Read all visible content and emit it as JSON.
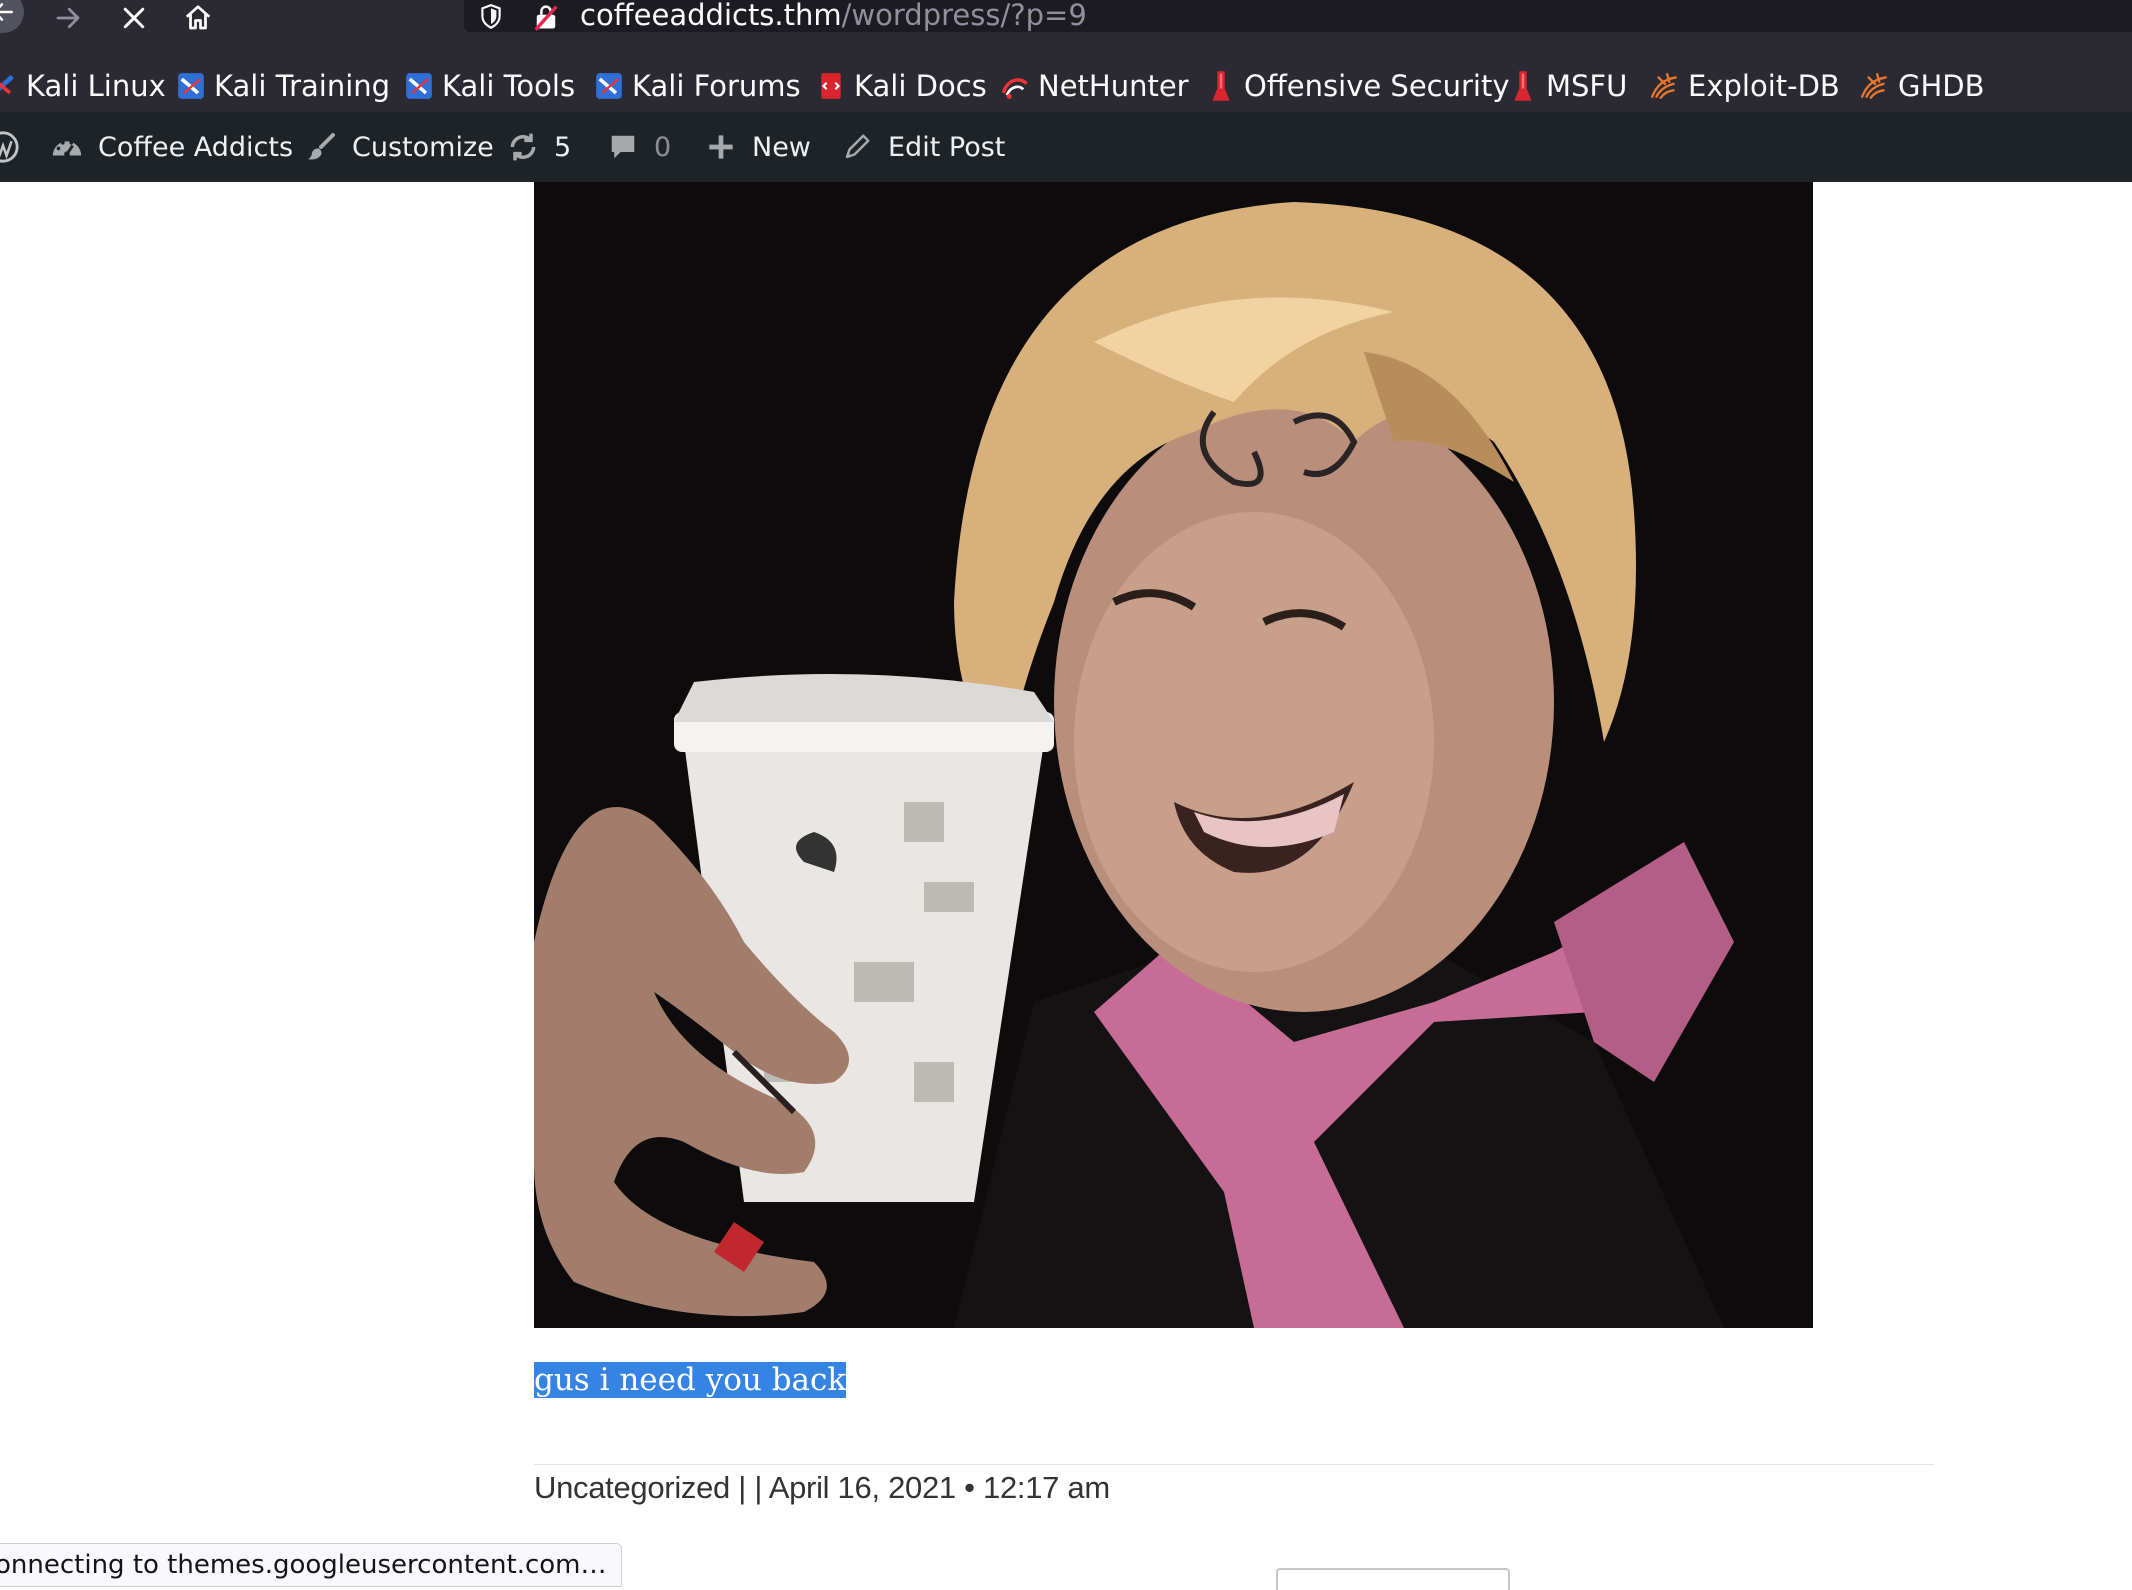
{
  "browser": {
    "nav_icons": [
      "back-arrow-icon",
      "forward-arrow-icon",
      "stop-x-icon",
      "home-icon"
    ],
    "url": {
      "host": "coffeeaddicts.thm",
      "path": "/wordpress/?p=9"
    },
    "bookmarks": [
      {
        "label": "Kali Linux",
        "icon": "kali-dragon-icon"
      },
      {
        "label": "Kali Training",
        "icon": "kali-dragon-icon"
      },
      {
        "label": "Kali Tools",
        "icon": "kali-dragon-icon"
      },
      {
        "label": "Kali Forums",
        "icon": "kali-dragon-icon"
      },
      {
        "label": "Kali Docs",
        "icon": "kali-docs-icon"
      },
      {
        "label": "NetHunter",
        "icon": "nethunter-icon"
      },
      {
        "label": "Offensive Security",
        "icon": "offsec-icon"
      },
      {
        "label": "MSFU",
        "icon": "offsec-icon"
      },
      {
        "label": "Exploit-DB",
        "icon": "exploitdb-icon"
      },
      {
        "label": "GHDB",
        "icon": "exploitdb-icon"
      }
    ],
    "status_text": "onnecting to themes.googleusercontent.com…"
  },
  "admin_bar": {
    "site_name": "Coffee Addicts",
    "customize": "Customize",
    "updates_count": "5",
    "comments_count": "0",
    "new_label": "New",
    "edit_label": "Edit Post"
  },
  "post": {
    "text": "gus i need you back",
    "meta": "Uncategorized | | April 16, 2021 • 12:17 am"
  },
  "colors": {
    "browser_chrome": "#2b2a33",
    "urlbar": "#1c1b22",
    "admin_bar": "#1d2327",
    "selection": "#3584e4"
  }
}
